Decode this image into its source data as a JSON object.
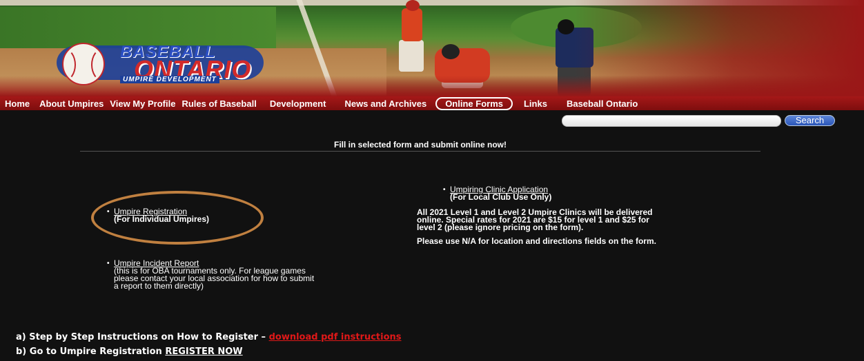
{
  "logo": {
    "line1": "BASEBALL",
    "line2": "ONTARIO",
    "line3": "UMPIRE DEVELOPMENT"
  },
  "nav": {
    "items": [
      "Home",
      "About Umpires",
      "View My Profile",
      "Rules of Baseball",
      "Development",
      "News and Archives",
      "Online Forms",
      "Links",
      "Baseball Ontario"
    ],
    "active": "Online Forms"
  },
  "search": {
    "value": "",
    "button": "Search"
  },
  "tagline": "Fill in selected form and submit online now!",
  "forms": {
    "registration": {
      "link": "Umpire Registration",
      "note": "(For Individual Umpires)"
    },
    "incident": {
      "link": "Umpire Incident Report",
      "note1": "(this is for OBA tournaments only. For league games",
      "note2": "please contact your local association for how to submit",
      "note3": "a report to them directly)"
    },
    "clinic": {
      "link": "Umpiring Clinic Application",
      "note": "(For Local Club Use Only)"
    }
  },
  "clinic_notice": {
    "line1": "All 2021 Level 1 and Level 2 Umpire Clinics will be delivered",
    "line2": "online.  Special rates for 2021 are $15 for level 1 and $25 for",
    "line3": "level 2 (please ignore pricing on the form).",
    "line4": "Please use N/A for location and directions fields on the form."
  },
  "instructions": {
    "a_text": "a) Step by Step Instructions on How to Register –",
    "a_link": "download pdf instructions",
    "b_text": "b) Go to Umpire Registration",
    "b_link": "REGISTER NOW"
  },
  "colors": {
    "nav_bg": "#9a1717",
    "oval": "#c08040",
    "pdf_link": "#e01818",
    "search_button": "#2a55b8"
  }
}
